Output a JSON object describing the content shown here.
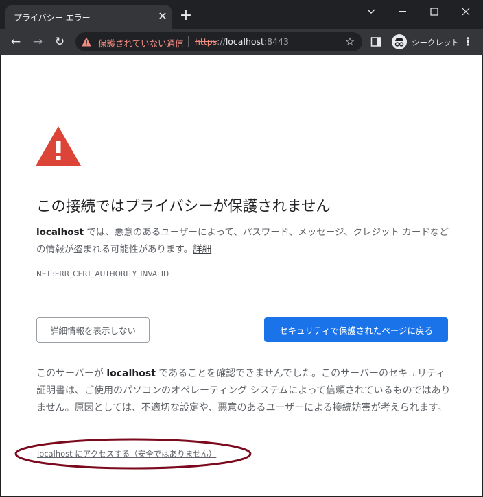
{
  "tab": {
    "title": "プライバシー エラー",
    "close": "✕",
    "new_tab": "+"
  },
  "window": {
    "minimize": "—",
    "maximize": "☐",
    "close": "✕",
    "dropdown": "⌄"
  },
  "toolbar": {
    "back": "←",
    "forward": "→",
    "reload": "↻",
    "security_label": "保護されていない通信",
    "url_scheme": "https",
    "url_sep": "://",
    "url_host": "localhost",
    "url_port": ":8443",
    "star": "☆",
    "incognito_label": "シークレット",
    "menu": "⋮"
  },
  "page": {
    "heading": "この接続ではプライバシーが保護されません",
    "main_host": "localhost",
    "main_text": " では、悪意のあるユーザーによって、パスワード、メッセージ、クレジット カードなどの情報が盗まれる可能性があります。",
    "details_link": "詳細",
    "error_code": "NET::ERR_CERT_AUTHORITY_INVALID",
    "hide_details_button": "詳細情報を表示しない",
    "back_button": "セキュリティで保護されたページに戻る",
    "detail_prefix": "このサーバーが ",
    "detail_host": "localhost",
    "detail_text": " であることを確認できませんでした。このサーバーのセキュリティ証明書は、ご使用のパソコンのオペレーティング システムによって信頼されているものではありません。原因としては、不適切な設定や、悪意のあるユーザーによる接続妨害が考えられます。",
    "proceed_link": "localhost にアクセスする（安全ではありません）"
  },
  "colors": {
    "warning_red": "#db4437",
    "primary_blue": "#1a73e8",
    "annotation_ellipse": "#7b0a1e"
  }
}
